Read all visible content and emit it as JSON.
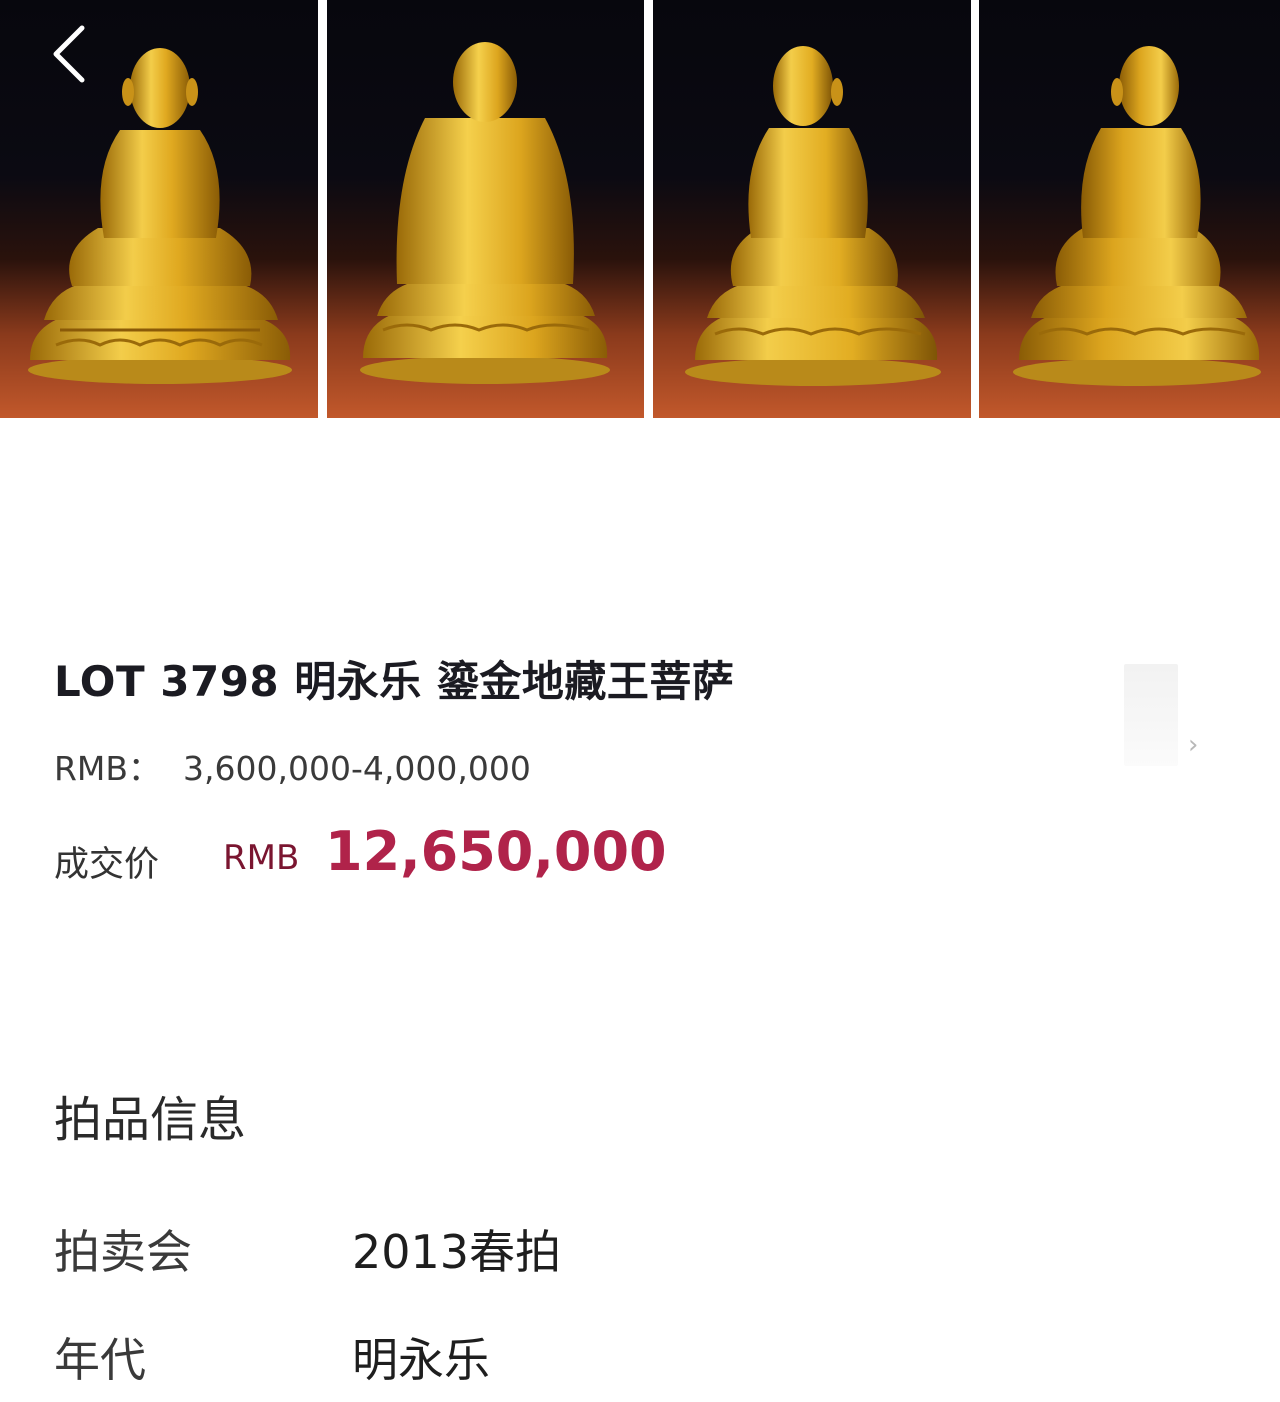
{
  "lot": {
    "title": "LOT 3798 明永乐 鎏金地藏王菩萨",
    "estimate_label": "RMB：",
    "estimate_value": "3,600,000-4,000,000",
    "price_label": "成交价",
    "price_currency": "RMB",
    "price_value": "12,650,000"
  },
  "gallery": {
    "views": [
      "front",
      "back",
      "three-quarter-left",
      "three-quarter-right"
    ]
  },
  "nav": {
    "back_icon": "chevron-left-icon"
  },
  "details": {
    "section_title": "拍品信息",
    "rows": [
      {
        "label": "拍卖会",
        "value": "2013春拍"
      },
      {
        "label": "年代",
        "value": "明永乐"
      }
    ]
  },
  "colors": {
    "price": "#b0234a",
    "currency": "#7a1530",
    "gold": "#e2b52a",
    "photo_bottom": "#c2582b"
  }
}
